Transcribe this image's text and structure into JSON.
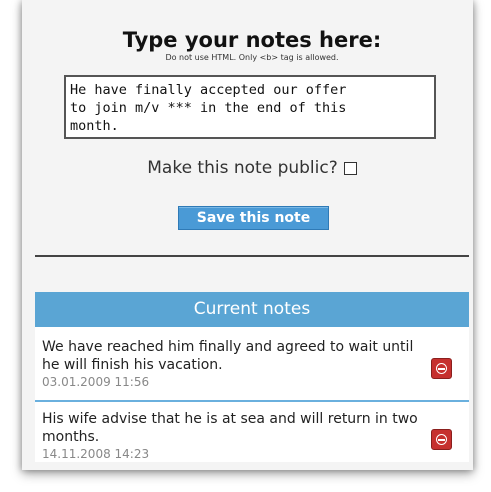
{
  "form": {
    "title": "Type your notes here:",
    "hint": "Do not use HTML. Only <b> tag is allowed.",
    "note_text": "He have finally accepted our offer\nto join m/v *** in the end of this\nmonth.",
    "public_label": "Make this note public?",
    "public_checked": false,
    "save_label": "Save this note"
  },
  "notes": {
    "header": "Current notes",
    "items": [
      {
        "text": "We have reached him finally and agreed to wait until he will finish his vacation.",
        "date": "03.01.2009 11:56",
        "delete_icon": "delete-icon"
      },
      {
        "text": "His wife advise that he is at sea and will return in two months.",
        "date": "14.11.2008 14:23",
        "delete_icon": "delete-icon"
      }
    ]
  }
}
